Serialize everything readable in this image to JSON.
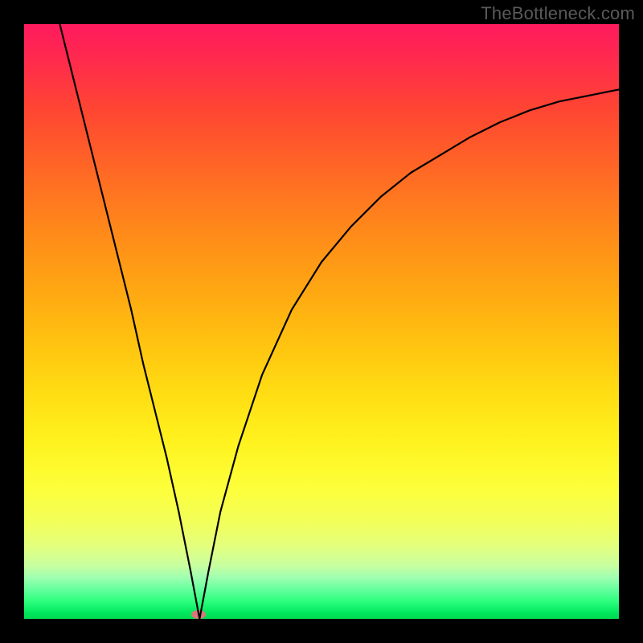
{
  "watermark": "TheBottleneck.com",
  "chart_data": {
    "type": "line",
    "title": "",
    "xlabel": "",
    "ylabel": "",
    "xlim": [
      0,
      100
    ],
    "ylim": [
      0,
      100
    ],
    "grid": false,
    "legend": false,
    "annotations": [],
    "background_gradient": {
      "direction": "vertical",
      "stops": [
        {
          "pct": 0,
          "color": "#ff1a5e"
        },
        {
          "pct": 25,
          "color": "#ff7a1f"
        },
        {
          "pct": 55,
          "color": "#ffdd13"
        },
        {
          "pct": 80,
          "color": "#f2ff5c"
        },
        {
          "pct": 95,
          "color": "#66ff9e"
        },
        {
          "pct": 100,
          "color": "#00d850"
        }
      ]
    },
    "marker": {
      "x": 29.5,
      "y": 0,
      "color": "#d87878",
      "shape": "ellipse"
    },
    "series": [
      {
        "name": "curve",
        "x": [
          6,
          8,
          10,
          12,
          14,
          16,
          18,
          20,
          22,
          24,
          26,
          28,
          29.5,
          31,
          33,
          36,
          40,
          45,
          50,
          55,
          60,
          65,
          70,
          75,
          80,
          85,
          90,
          95,
          100
        ],
        "values": [
          100,
          92,
          84,
          76,
          68,
          60,
          52,
          43,
          35,
          27,
          18,
          8,
          0,
          8,
          18,
          29,
          41,
          52,
          60,
          66,
          71,
          75,
          78,
          81,
          83.5,
          85.5,
          87,
          88,
          89
        ]
      }
    ]
  }
}
